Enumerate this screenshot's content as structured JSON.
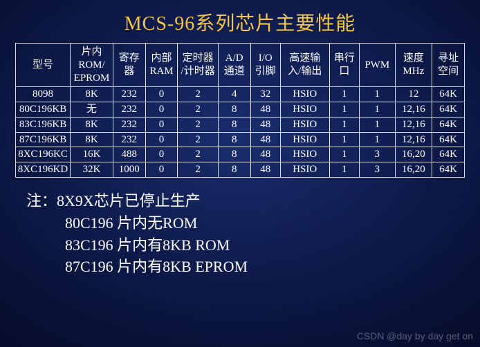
{
  "title": "MCS-96系列芯片主要性能",
  "headers": [
    "型号",
    "片内\nROM/\nEPROM",
    "寄存\n器",
    "内部\nRAM",
    "定时器\n/计时器",
    "A/D\n通道",
    "I/O\n引脚",
    "高速输\n入/输出",
    "串行\n口",
    "PWM",
    "速度\nMHz",
    "寻址\n空间"
  ],
  "rows": [
    [
      "8098",
      "8K",
      "232",
      "0",
      "2",
      "4",
      "32",
      "HSIO",
      "1",
      "1",
      "12",
      "64K"
    ],
    [
      "80C196KB",
      "无",
      "232",
      "0",
      "2",
      "8",
      "48",
      "HSIO",
      "1",
      "1",
      "12,16",
      "64K"
    ],
    [
      "83C196KB",
      "8K",
      "232",
      "0",
      "2",
      "8",
      "48",
      "HSIO",
      "1",
      "1",
      "12,16",
      "64K"
    ],
    [
      "87C196KB",
      "8K",
      "232",
      "0",
      "2",
      "8",
      "48",
      "HSIO",
      "1",
      "1",
      "12,16",
      "64K"
    ],
    [
      "8XC196KC",
      "16K",
      "488",
      "0",
      "2",
      "8",
      "48",
      "HSIO",
      "1",
      "3",
      "16,20",
      "64K"
    ],
    [
      "8XC196KD",
      "32K",
      "1000",
      "0",
      "2",
      "8",
      "48",
      "HSIO",
      "1",
      "3",
      "16,20",
      "64K"
    ]
  ],
  "notes": {
    "lead": "注：8X9X芯片已停止生产",
    "lines": [
      "80C196   片内无ROM",
      "83C196   片内有8KB  ROM",
      "87C196   片内有8KB  EPROM"
    ]
  },
  "watermark": "CSDN @day by day get on"
}
